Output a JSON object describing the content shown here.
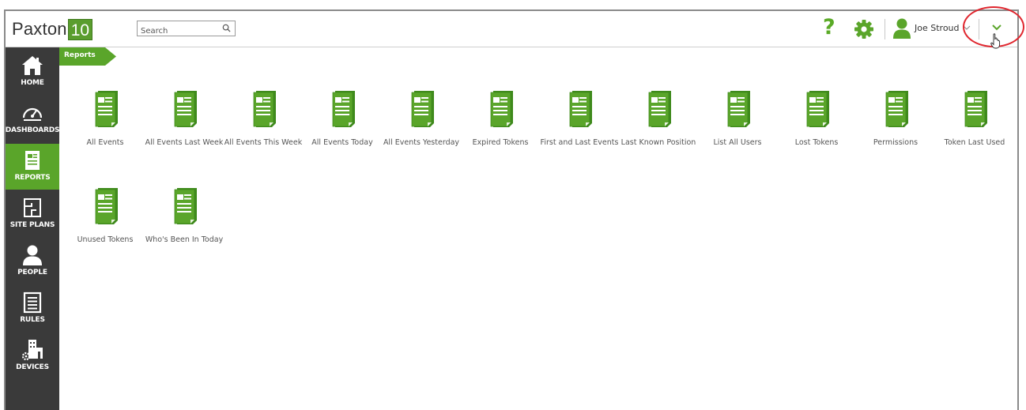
{
  "app": {
    "logo_text": "Paxton",
    "logo_num": "10"
  },
  "header": {
    "search_placeholder": "Search",
    "help_label": "?",
    "user_name": "Joe Stroud"
  },
  "sidebar": {
    "items": [
      {
        "label": "HOME",
        "icon": "home-icon"
      },
      {
        "label": "DASHBOARDS",
        "icon": "dashboard-gauge-icon"
      },
      {
        "label": "REPORTS",
        "icon": "report-icon",
        "active": true
      },
      {
        "label": "SITE PLANS",
        "icon": "site-plan-icon"
      },
      {
        "label": "PEOPLE",
        "icon": "person-icon"
      },
      {
        "label": "RULES",
        "icon": "rules-list-icon"
      },
      {
        "label": "DEVICES",
        "icon": "devices-icon"
      }
    ]
  },
  "breadcrumb": {
    "label": "Reports"
  },
  "reports": [
    {
      "label": "All Events"
    },
    {
      "label": "All Events Last Week"
    },
    {
      "label": "All Events This Week"
    },
    {
      "label": "All Events Today"
    },
    {
      "label": "All Events Yesterday"
    },
    {
      "label": "Expired Tokens"
    },
    {
      "label": "First and Last Events"
    },
    {
      "label": "Last Known Position"
    },
    {
      "label": "List All Users"
    },
    {
      "label": "Lost Tokens"
    },
    {
      "label": "Permissions"
    },
    {
      "label": "Token Last Used"
    },
    {
      "label": "Unused Tokens"
    },
    {
      "label": "Who's Been In Today"
    }
  ],
  "colors": {
    "brand_green": "#5aa52a",
    "sidebar": "#3a3a3a",
    "highlight": "#e0262e"
  }
}
